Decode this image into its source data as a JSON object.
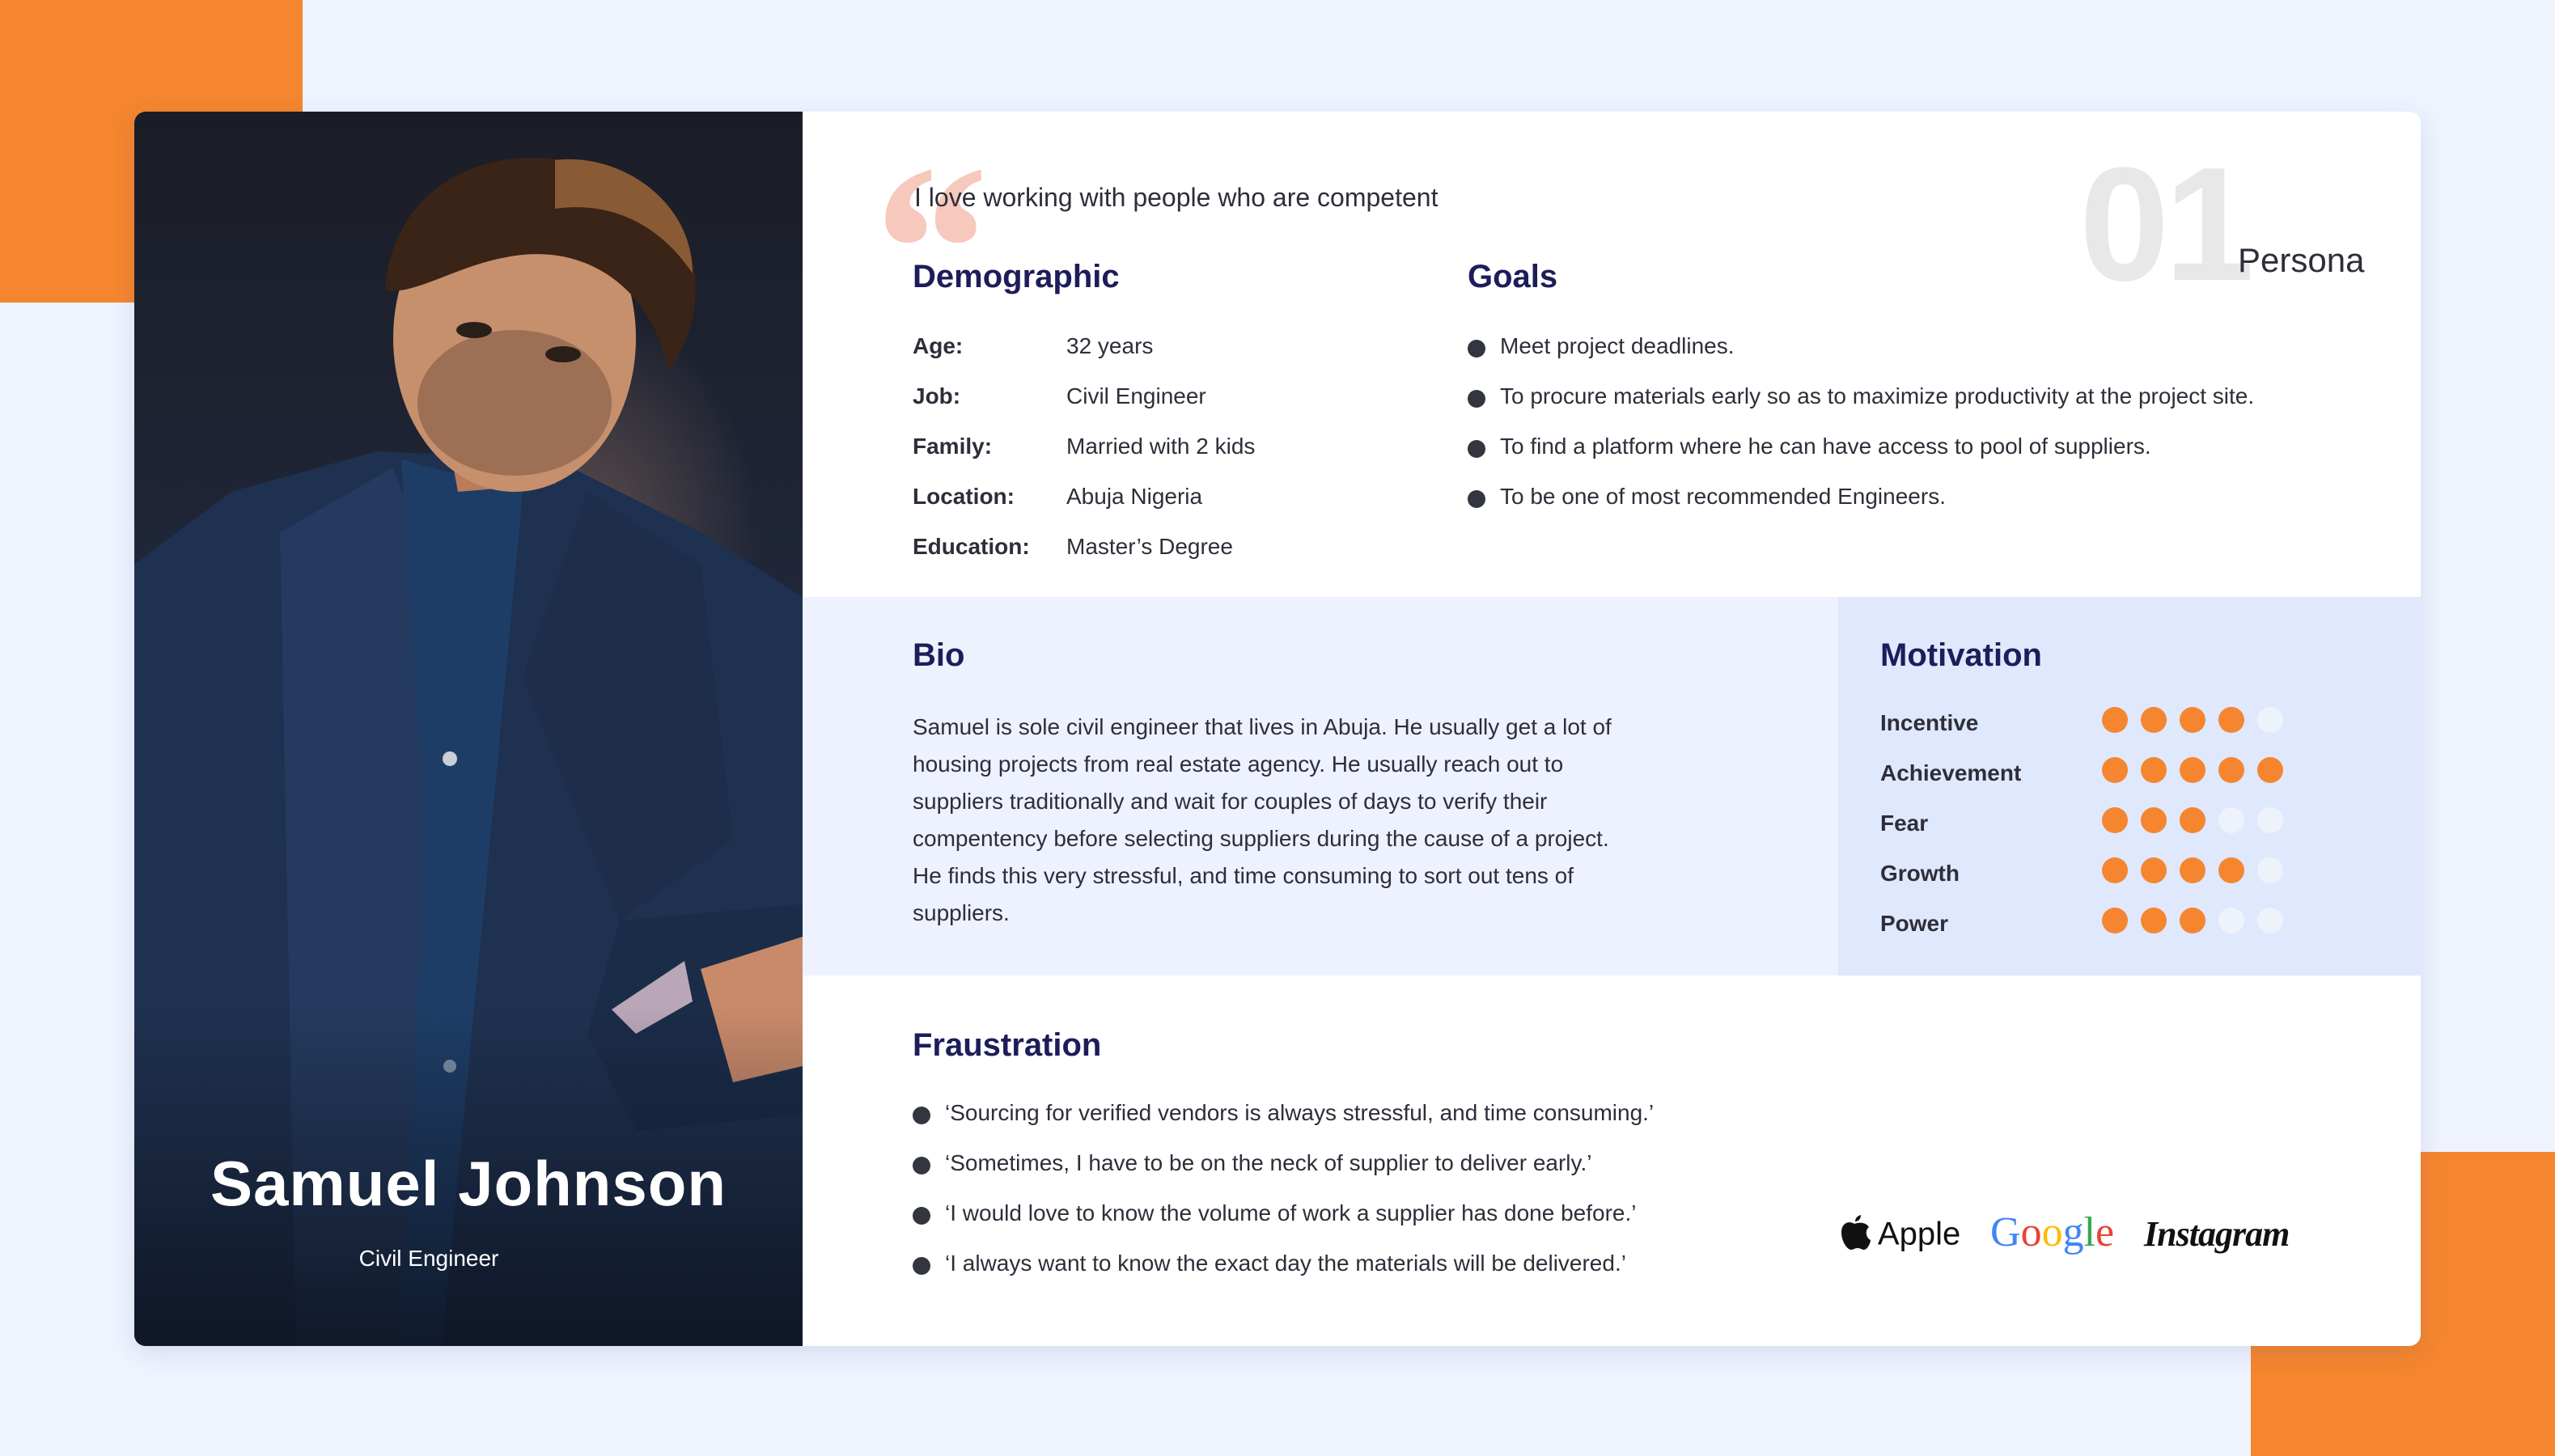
{
  "persona": {
    "name": "Samuel Johnson",
    "role": "Civil Engineer",
    "quote": "I love working with people who are competent",
    "number": "01",
    "label": "Persona"
  },
  "demographic": {
    "title": "Demographic",
    "rows": [
      {
        "key": "Age:",
        "value": "32 years"
      },
      {
        "key": "Job:",
        "value": "Civil Engineer"
      },
      {
        "key": "Family:",
        "value": "Married with 2 kids"
      },
      {
        "key": "Location:",
        "value": "Abuja Nigeria"
      },
      {
        "key": "Education:",
        "value": "Master’s Degree"
      }
    ]
  },
  "goals": {
    "title": "Goals",
    "items": [
      "Meet project deadlines.",
      "To procure materials early so as to maximize productivity at the project site.",
      "To find a platform where he can have access to pool of suppliers.",
      "To be one of most recommended Engineers."
    ]
  },
  "bio": {
    "title": "Bio",
    "lines": [
      "Samuel is sole civil engineer that lives in Abuja. He usually get a lot of",
      "housing projects from real estate agency.  He usually reach out to",
      "suppliers traditionally and wait for couples of days to verify their",
      "compentency before selecting suppliers during the cause of a project.",
      "He finds this very  stressful, and time consuming to sort out tens of",
      "suppliers."
    ]
  },
  "motivation": {
    "title": "Motivation",
    "max": 5,
    "colors": {
      "on": "#f5862f",
      "off": "#eef2fb"
    },
    "items": [
      {
        "label": "Incentive",
        "level": 4
      },
      {
        "label": "Achievement",
        "level": 5
      },
      {
        "label": "Fear",
        "level": 3
      },
      {
        "label": "Growth",
        "level": 4
      },
      {
        "label": "Power",
        "level": 3
      }
    ]
  },
  "frustration": {
    "title": "Fraustration",
    "items": [
      "‘Sourcing for verified vendors is always stressful, and time consuming.’",
      "‘Sometimes, I have to be on the neck of supplier to deliver early.’",
      "‘I would love to know the volume of work a supplier has done before.’",
      "‘I always want to know the exact day the materials will be delivered.’"
    ]
  },
  "brands": {
    "apple": "Apple",
    "google": "Google",
    "instagram": "Instagram",
    "google_colors": [
      "#4285f4",
      "#ea4335",
      "#fbbc05",
      "#4285f4",
      "#34a853",
      "#ea4335"
    ]
  },
  "theme": {
    "accent": "#f5862f",
    "heading": "#1d1d5a",
    "background": "#eef3fe"
  }
}
